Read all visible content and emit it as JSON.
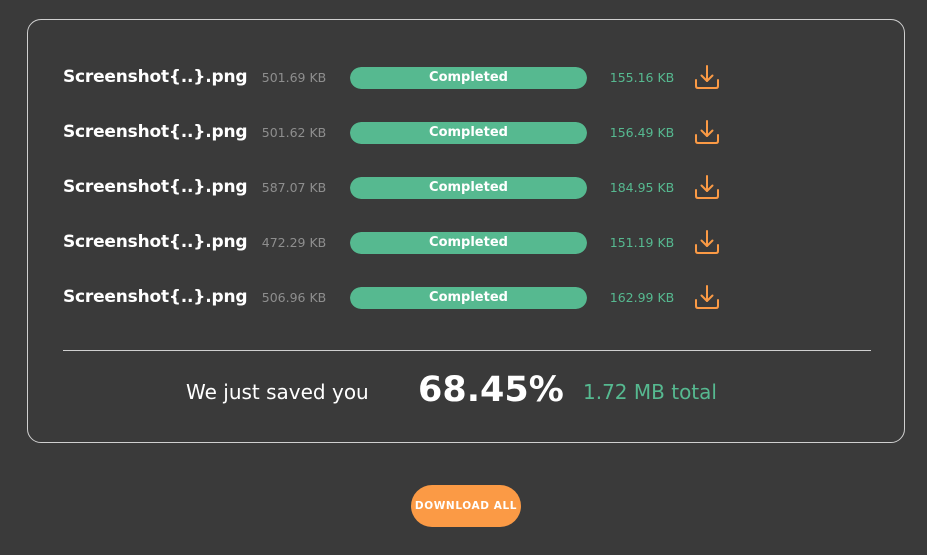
{
  "files": [
    {
      "name": "Screenshot{..}.png",
      "original_size": "501.69 KB",
      "status": "Completed",
      "progress": 1.0,
      "new_size": "155.16 KB"
    },
    {
      "name": "Screenshot{..}.png",
      "original_size": "501.62 KB",
      "status": "Completed",
      "progress": 1.0,
      "new_size": "156.49 KB"
    },
    {
      "name": "Screenshot{..}.png",
      "original_size": "587.07 KB",
      "status": "Completed",
      "progress": 1.0,
      "new_size": "184.95 KB"
    },
    {
      "name": "Screenshot{..}.png",
      "original_size": "472.29 KB",
      "status": "Completed",
      "progress": 1.0,
      "new_size": "151.19 KB"
    },
    {
      "name": "Screenshot{..}.png",
      "original_size": "506.96 KB",
      "status": "Completed",
      "progress": 1.0,
      "new_size": "162.99 KB"
    }
  ],
  "summary": {
    "text": "We just saved you",
    "percent": "68.45%",
    "total": "1.72 MB total"
  },
  "download_all_label": "DOWNLOAD ALL",
  "icons": {
    "row_download": "download-icon"
  },
  "colors": {
    "background": "#3a3a3a",
    "accent_green": "#56b990",
    "accent_orange": "#fb9a45",
    "muted_text": "#8e8e8e"
  }
}
